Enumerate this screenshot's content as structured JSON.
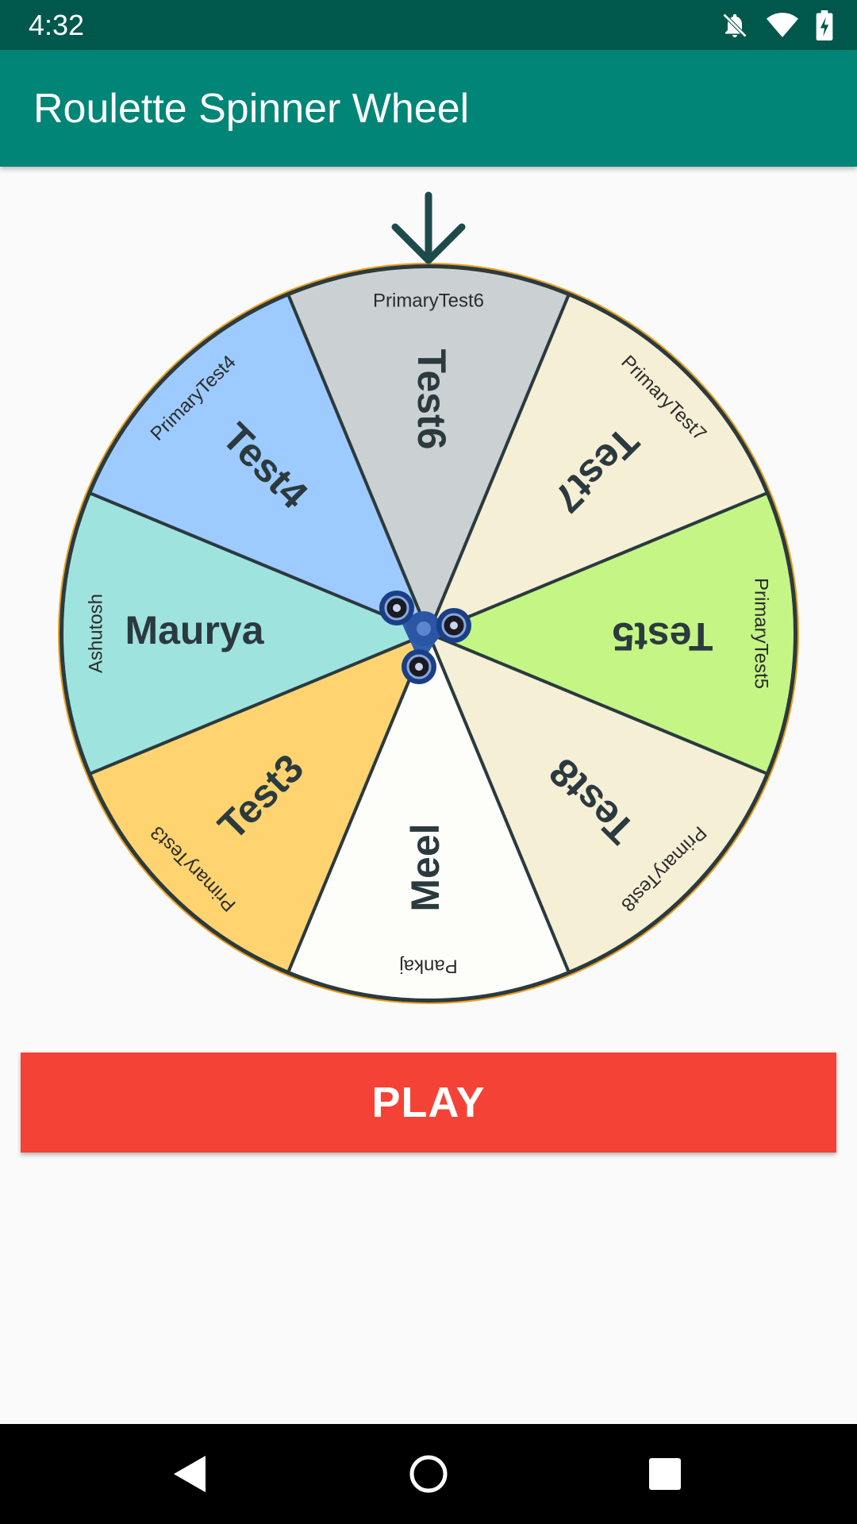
{
  "status_bar": {
    "time": "4:32",
    "icons": [
      "notifications-off-icon",
      "wifi-icon",
      "battery-charging-icon"
    ]
  },
  "app_bar": {
    "title": "Roulette Spinner Wheel"
  },
  "wheel": {
    "pointer_icon": "arrow-down-icon",
    "center_icon": "fidget-spinner-icon",
    "rim_color": "#2b3a3f",
    "outer_ring_color": "#e8a020",
    "segments": [
      {
        "title": "Test6",
        "subtitle": "PrimaryTest6",
        "color": "#cbd1d3"
      },
      {
        "title": "Test7",
        "subtitle": "PrimaryTest7",
        "color": "#f5efd6"
      },
      {
        "title": "Test5",
        "subtitle": "PrimaryTest5",
        "color": "#c5f585"
      },
      {
        "title": "Test8",
        "subtitle": "PrimaryTest8",
        "color": "#f5efd6"
      },
      {
        "title": "Meel",
        "subtitle": "Pankaj",
        "color": "#fdfdf9"
      },
      {
        "title": "Test3",
        "subtitle": "PrimaryTest3",
        "color": "#ffd470"
      },
      {
        "title": "Maurya",
        "subtitle": "Ashutosh",
        "color": "#9fe3df"
      },
      {
        "title": "Test4",
        "subtitle": "PrimaryTest4",
        "color": "#9dcbff"
      }
    ]
  },
  "play_button": {
    "label": "PLAY",
    "color": "#f44336"
  },
  "nav_bar": {
    "icons": [
      "back-icon",
      "home-icon",
      "recents-icon"
    ]
  }
}
